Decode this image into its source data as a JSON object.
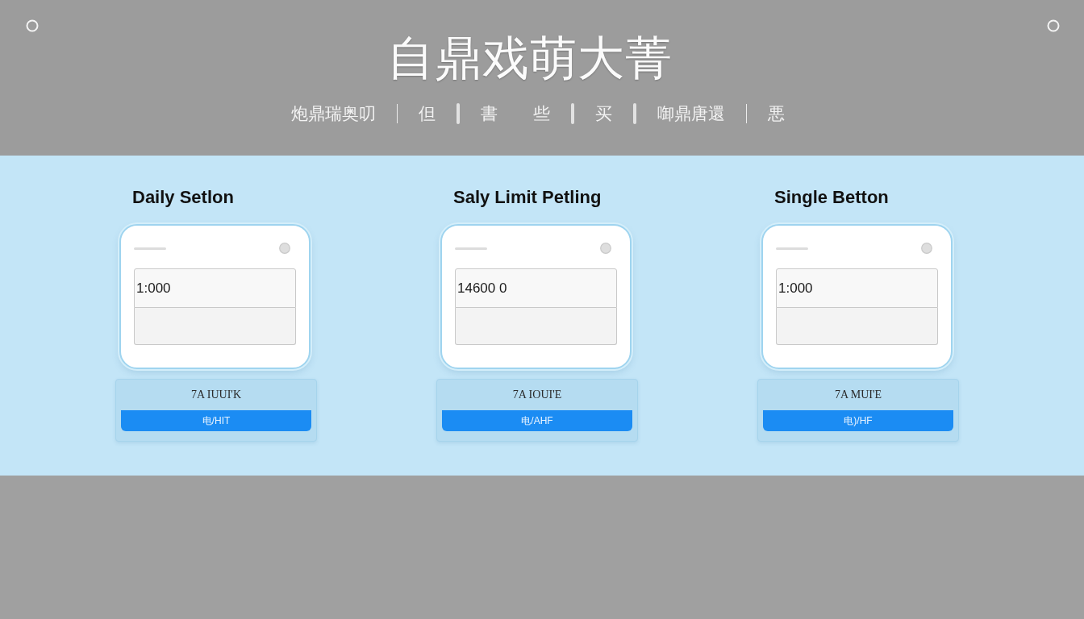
{
  "header": {
    "title": "自鼎戏萌大菁",
    "nav": [
      {
        "label": "炮鼎瑞奥叨",
        "kind": "line"
      },
      {
        "label": "但",
        "kind": "bar"
      },
      {
        "label": "書",
        "kind": "plain"
      },
      {
        "label": "些",
        "kind": "bar"
      },
      {
        "label": "买",
        "kind": "bar"
      },
      {
        "label": "啣鼎唐還",
        "kind": "line"
      },
      {
        "label": "悪",
        "kind": "plain"
      }
    ]
  },
  "settings": [
    {
      "title": "Daily Setlon",
      "value": "1:000",
      "caption": "7A IUUI'K",
      "button": "电/HIT"
    },
    {
      "title": "Saly Limit Petling",
      "value": "14600 0",
      "caption": "7A IOUI'E",
      "button": "电/AHF"
    },
    {
      "title": "Single Betton",
      "value": "1:000",
      "caption": "7A MUI'E",
      "button": "电)/HF"
    }
  ]
}
